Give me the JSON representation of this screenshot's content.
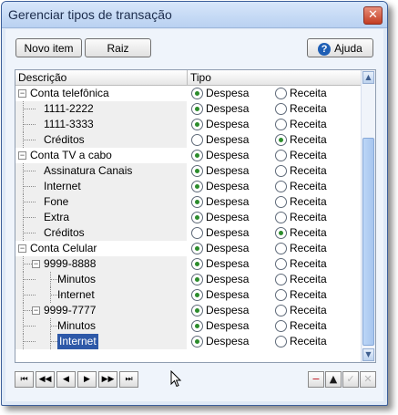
{
  "window": {
    "title": "Gerenciar tipos de transação"
  },
  "toolbar": {
    "new_item_label": "Novo item",
    "root_label": "Raiz",
    "help_label": "Ajuda"
  },
  "grid": {
    "columns": [
      "Descrição",
      "Tipo"
    ],
    "options": [
      "Despesa",
      "Receita"
    ],
    "rows": [
      {
        "label": "Conta telefônica",
        "depth": 0,
        "expander": "−",
        "type": "Despesa"
      },
      {
        "label": "1111-2222",
        "depth": 1,
        "type": "Despesa"
      },
      {
        "label": "1111-3333",
        "depth": 1,
        "type": "Despesa"
      },
      {
        "label": "Créditos",
        "depth": 1,
        "type": "Receita"
      },
      {
        "label": "Conta TV a cabo",
        "depth": 0,
        "expander": "−",
        "type": "Despesa"
      },
      {
        "label": "Assinatura Canais",
        "depth": 1,
        "type": "Despesa"
      },
      {
        "label": "Internet",
        "depth": 1,
        "type": "Despesa"
      },
      {
        "label": "Fone",
        "depth": 1,
        "type": "Despesa"
      },
      {
        "label": "Extra",
        "depth": 1,
        "type": "Despesa"
      },
      {
        "label": "Créditos",
        "depth": 1,
        "type": "Receita"
      },
      {
        "label": "Conta Celular",
        "depth": 0,
        "expander": "−",
        "type": "Despesa"
      },
      {
        "label": "9999-8888",
        "depth": 1,
        "expander": "−",
        "type": "Despesa"
      },
      {
        "label": "Minutos",
        "depth": 2,
        "type": "Despesa"
      },
      {
        "label": "Internet",
        "depth": 2,
        "type": "Despesa"
      },
      {
        "label": "9999-7777",
        "depth": 1,
        "expander": "−",
        "type": "Despesa"
      },
      {
        "label": "Minutos",
        "depth": 2,
        "type": "Despesa"
      },
      {
        "label": "Internet",
        "depth": 2,
        "type": "Despesa",
        "selected": true
      }
    ]
  },
  "navigator": {
    "buttons": [
      {
        "name": "first-record-button",
        "glyph": "⏮"
      },
      {
        "name": "prev-page-button",
        "glyph": "◀◀"
      },
      {
        "name": "prev-record-button",
        "glyph": "◀"
      },
      {
        "name": "next-record-button",
        "glyph": "▶"
      },
      {
        "name": "next-page-button",
        "glyph": "▶▶"
      },
      {
        "name": "last-record-button",
        "glyph": "⏭"
      }
    ]
  },
  "edit_buttons": [
    {
      "name": "delete-button",
      "glyph": "−",
      "color": "#c0121d"
    },
    {
      "name": "edit-up-button",
      "glyph": "▲",
      "color": "#1a1a1a"
    },
    {
      "name": "confirm-button",
      "glyph": "✓",
      "color": "#b5b5b5"
    },
    {
      "name": "cancel-button",
      "glyph": "✕",
      "color": "#b5b5b5"
    }
  ],
  "colors": {
    "selection": "#2e59a8",
    "radio_checked": "#2c8c2c",
    "accent": "#1f5fb5"
  }
}
